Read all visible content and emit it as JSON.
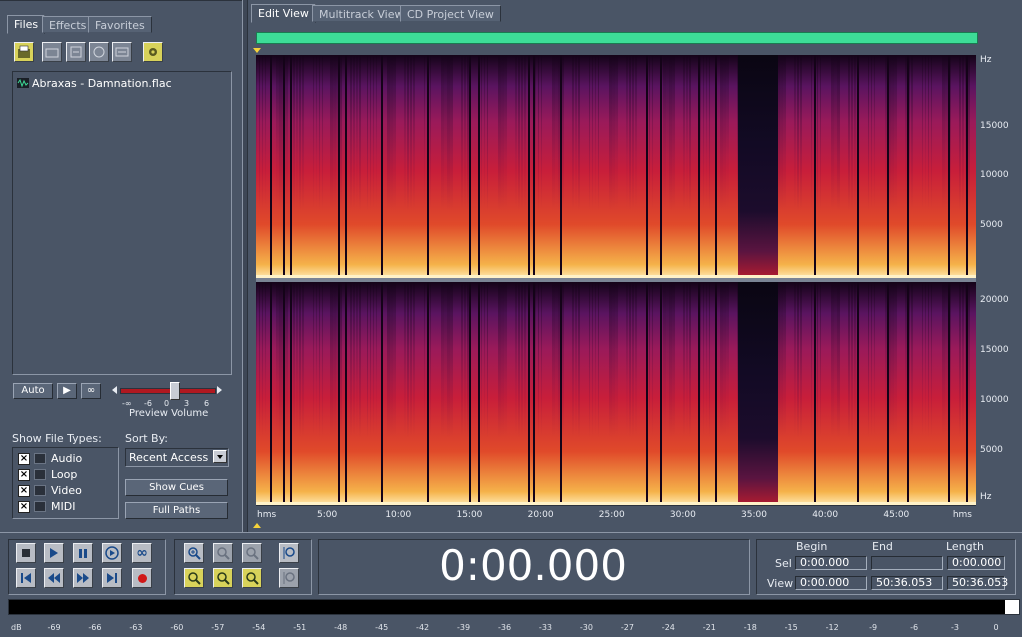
{
  "left_panel": {
    "tabs": [
      {
        "label": "Files",
        "active": true
      },
      {
        "label": "Effects",
        "active": false
      },
      {
        "label": "Favorites",
        "active": false
      }
    ],
    "toolbar_icons": [
      "open-file-icon",
      "folder-icon",
      "import-icon",
      "close-file-icon",
      "insert-icon",
      "settings-icon"
    ],
    "files": [
      {
        "name": "Abraxas - Damnation.flac",
        "icon": "waveform-icon"
      }
    ],
    "auto_label": "Auto",
    "preview_volume": {
      "label": "Preview Volume",
      "scale": [
        "-∞",
        "-6",
        "0",
        "3",
        "6"
      ],
      "level_fraction": 0.57
    },
    "show_file_types": {
      "label": "Show File Types:",
      "items": [
        {
          "label": "Audio",
          "checked": true,
          "icon": "audio-icon"
        },
        {
          "label": "Loop",
          "checked": true,
          "icon": "loop-icon"
        },
        {
          "label": "Video",
          "checked": true,
          "icon": "video-icon"
        },
        {
          "label": "MIDI",
          "checked": true,
          "icon": "midi-icon"
        }
      ]
    },
    "sort_by": {
      "label": "Sort By:",
      "value": "Recent Access"
    },
    "show_cues_label": "Show Cues",
    "full_paths_label": "Full Paths"
  },
  "view_tabs": [
    {
      "label": "Edit View",
      "active": true
    },
    {
      "label": "Multitrack View",
      "active": false
    },
    {
      "label": "CD Project View",
      "active": false
    }
  ],
  "spectral": {
    "y_axis_top": {
      "unit": "Hz",
      "ticks": [
        "15000",
        "10000",
        "5000"
      ]
    },
    "y_axis_bottom": {
      "unit": "Hz",
      "ticks": [
        "20000",
        "15000",
        "10000",
        "5000"
      ]
    },
    "x_axis": {
      "start_label": "hms",
      "end_label": "hms",
      "ticks": [
        "5:00",
        "10:00",
        "15:00",
        "20:00",
        "25:00",
        "30:00",
        "35:00",
        "40:00",
        "45:00"
      ],
      "tick_minutes": [
        5,
        10,
        15,
        20,
        25,
        30,
        35,
        40,
        45
      ],
      "duration_minutes": 50.6
    },
    "silent_gaps_minutes": [
      [
        33.9,
        36.7
      ]
    ],
    "colors": {
      "low": "#140318",
      "mid": "#c81e3a",
      "high": "#f5b24a",
      "overview": "#3ddc97"
    }
  },
  "transport": {
    "icons": [
      "stop-icon",
      "play-icon",
      "pause-icon",
      "play-to-end-icon",
      "loop-icon",
      "go-to-start-icon",
      "rewind-icon",
      "fast-forward-icon",
      "go-to-end-icon",
      "record-icon"
    ]
  },
  "zoom": {
    "icons": [
      "zoom-in-icon",
      "zoom-out-icon",
      "zoom-full-icon",
      "zoom-vertical-in-icon",
      "zoom-selection-icon",
      "zoom-left-icon",
      "zoom-right-icon",
      "zoom-vertical-out-icon"
    ]
  },
  "time_display": "0:00.000",
  "selection": {
    "headers": [
      "Begin",
      "End",
      "Length"
    ],
    "sel": {
      "label": "Sel",
      "begin": "0:00.000",
      "end": "",
      "length": "0:00.000"
    },
    "view": {
      "label": "View",
      "begin": "0:00.000",
      "end": "50:36.053",
      "length": "50:36.053"
    }
  },
  "level_meter": {
    "unit": "dB",
    "labels": [
      "-69",
      "-66",
      "-63",
      "-60",
      "-57",
      "-54",
      "-51",
      "-48",
      "-45",
      "-42",
      "-39",
      "-36",
      "-33",
      "-30",
      "-27",
      "-24",
      "-21",
      "-18",
      "-15",
      "-12",
      "-9",
      "-6",
      "-3",
      "0"
    ]
  }
}
